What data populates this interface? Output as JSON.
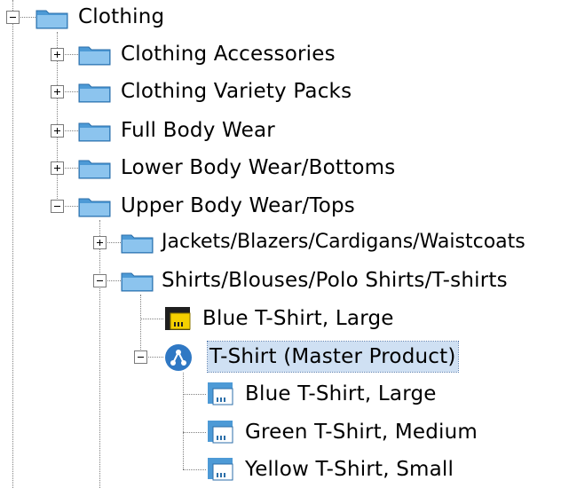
{
  "tree": {
    "nodes": [
      {
        "id": "clothing",
        "label": "Clothing",
        "icon": "folder-icon",
        "state": "expanded"
      },
      {
        "id": "clothing-accessories",
        "label": "Clothing Accessories",
        "icon": "folder-icon",
        "state": "collapsed"
      },
      {
        "id": "clothing-variety-packs",
        "label": "Clothing Variety Packs",
        "icon": "folder-icon",
        "state": "collapsed"
      },
      {
        "id": "full-body-wear",
        "label": "Full Body Wear",
        "icon": "folder-icon",
        "state": "collapsed"
      },
      {
        "id": "lower-body-wear",
        "label": "Lower Body Wear/Bottoms",
        "icon": "folder-icon",
        "state": "collapsed"
      },
      {
        "id": "upper-body-wear",
        "label": "Upper Body Wear/Tops",
        "icon": "folder-icon",
        "state": "expanded"
      },
      {
        "id": "jackets",
        "label": "Jackets/Blazers/Cardigans/Waistcoats",
        "icon": "folder-icon",
        "state": "collapsed"
      },
      {
        "id": "shirts",
        "label": "Shirts/Blouses/Polo Shirts/T-shirts",
        "icon": "folder-icon",
        "state": "expanded"
      },
      {
        "id": "blue-tshirt-large",
        "label": "Blue T-Shirt, Large",
        "icon": "product-icon",
        "state": "leaf"
      },
      {
        "id": "tshirt-master",
        "label": "T-Shirt (Master Product)",
        "icon": "master-product-icon",
        "state": "expanded",
        "selected": true
      },
      {
        "id": "variant-blue-large",
        "label": "Blue T-Shirt, Large",
        "icon": "variant-icon",
        "state": "leaf"
      },
      {
        "id": "variant-green-medium",
        "label": "Green T-Shirt, Medium",
        "icon": "variant-icon",
        "state": "leaf"
      },
      {
        "id": "variant-yellow-small",
        "label": "Yellow T-Shirt, Small",
        "icon": "variant-icon",
        "state": "leaf"
      }
    ]
  },
  "colors": {
    "folder": "#4d9ad6",
    "selection": "#cfe0f3",
    "master_product": "#2f78c4",
    "product_yellow": "#f5d000"
  }
}
